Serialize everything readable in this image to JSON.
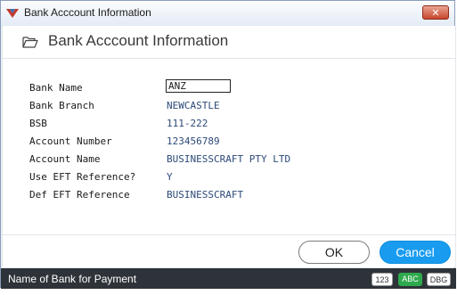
{
  "window": {
    "title": "Bank Acccount Information"
  },
  "header": {
    "title": "Bank Acccount Information"
  },
  "form": {
    "bank_name": {
      "label": "Bank Name",
      "value": "ANZ"
    },
    "bank_branch": {
      "label": "Bank Branch",
      "value": "NEWCASTLE"
    },
    "bsb": {
      "label": "BSB",
      "value": "111-222"
    },
    "account_number": {
      "label": "Account Number",
      "value": "123456789"
    },
    "account_name": {
      "label": "Account Name",
      "value": "BUSINESSCRAFT PTY LTD"
    },
    "use_eft_reference": {
      "label": "Use EFT Reference?",
      "value": "Y"
    },
    "def_eft_reference": {
      "label": "Def EFT Reference",
      "value": "BUSINESSCRAFT"
    }
  },
  "buttons": {
    "ok": "OK",
    "cancel": "Cancel"
  },
  "status": {
    "text": "Name of Bank for Payment",
    "badges": [
      "123",
      "ABC",
      "DBG"
    ]
  },
  "colors": {
    "accent": "#199cf0",
    "status_bg": "#2e3339",
    "abc_badge": "#2fa94e",
    "value_text": "#2c4a78"
  }
}
